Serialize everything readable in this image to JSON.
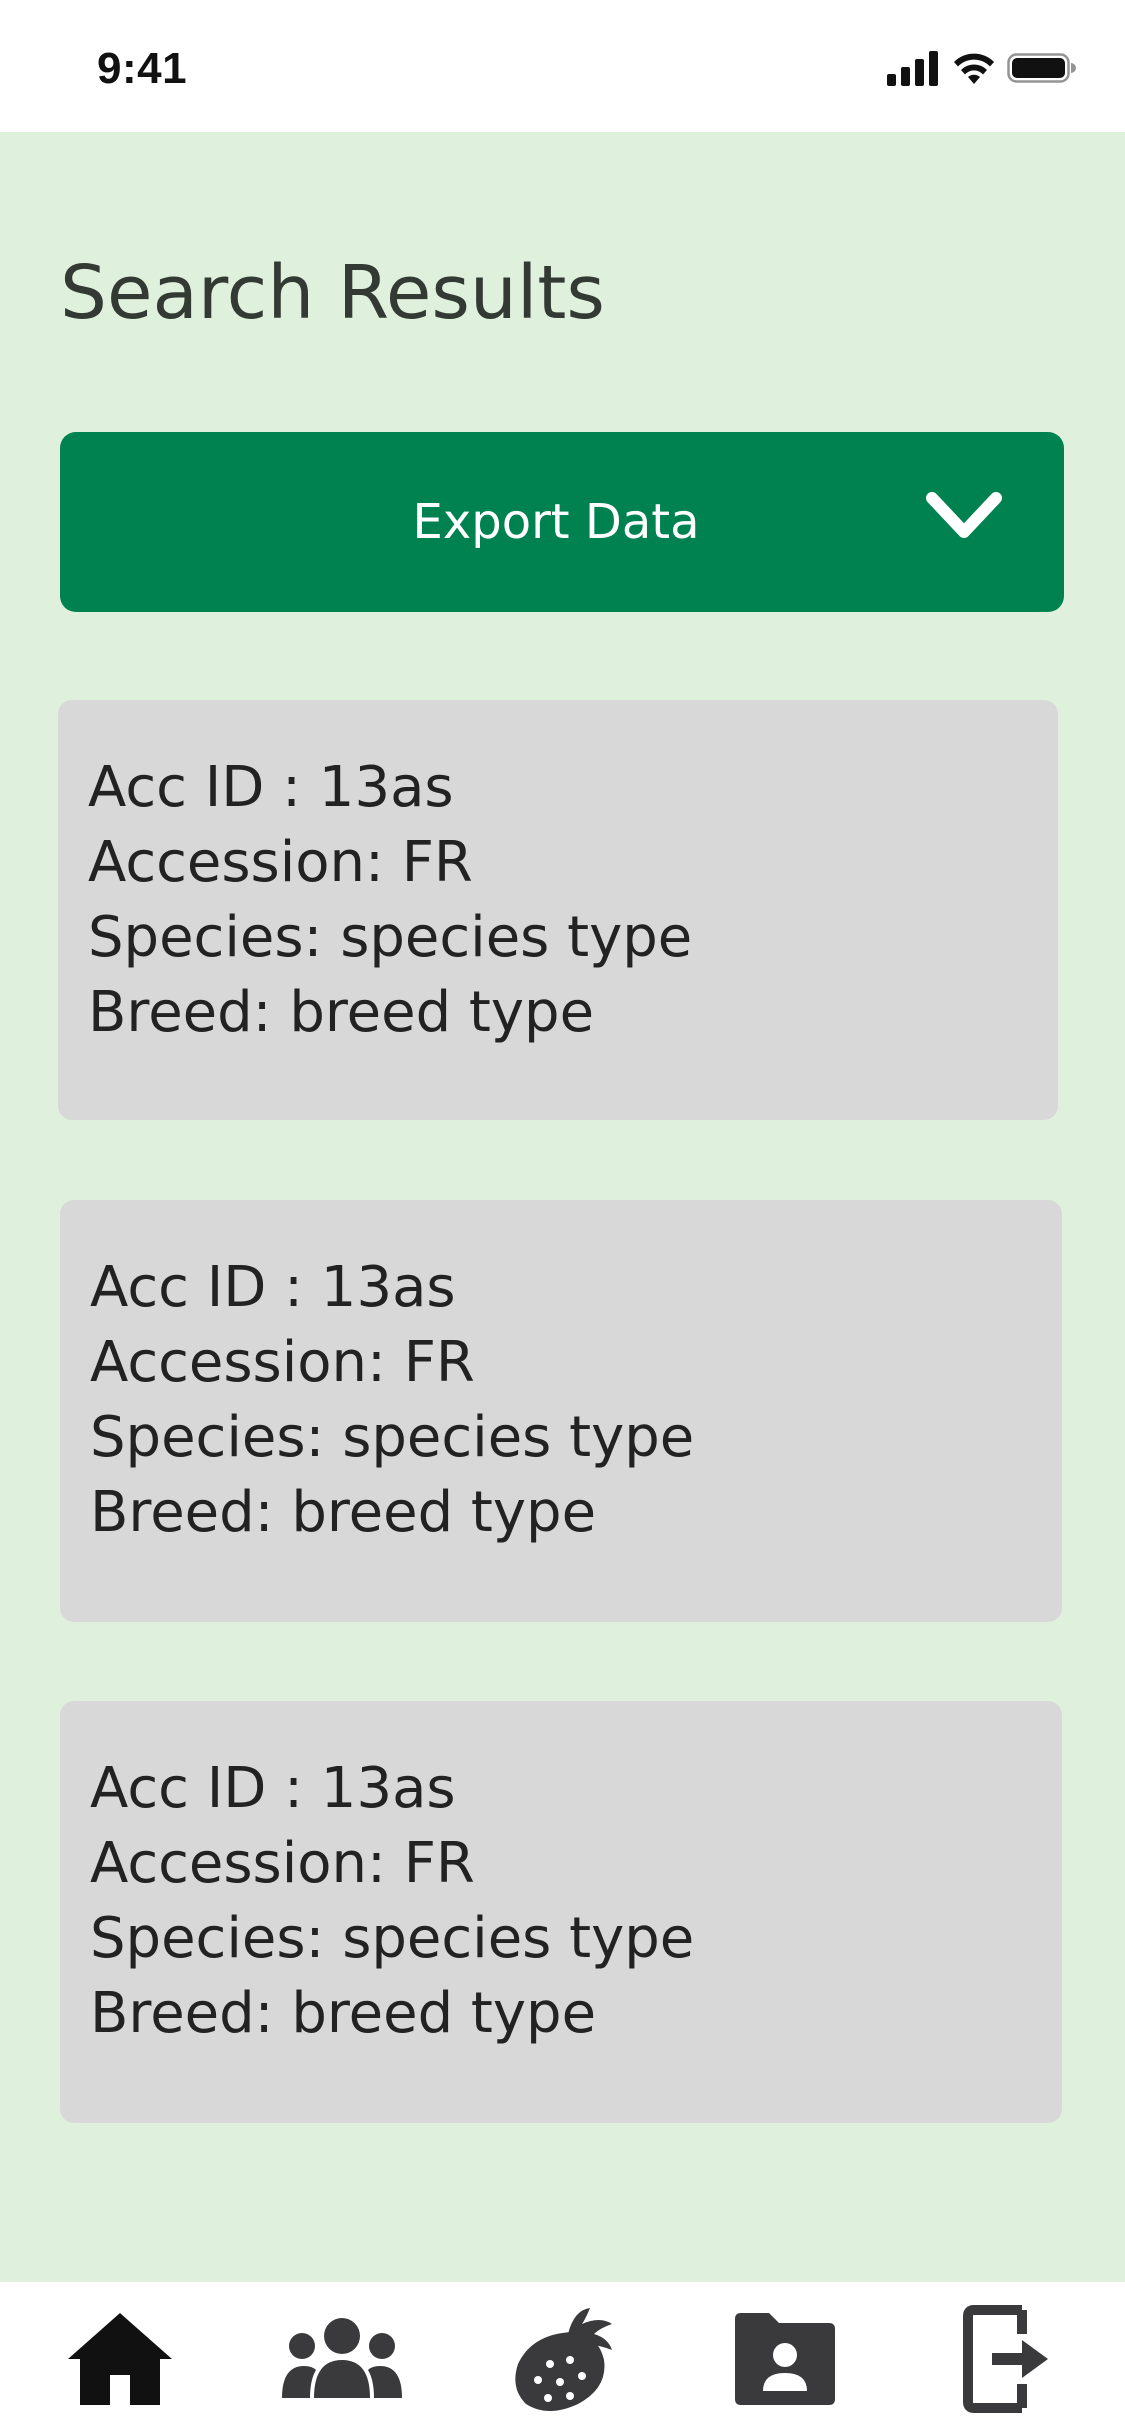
{
  "status_bar": {
    "time": "9:41"
  },
  "page": {
    "title": "Search Results"
  },
  "export": {
    "label": "Export Data",
    "icon": "chevron-down-icon"
  },
  "results": [
    {
      "acc_id": "Acc ID : 13as",
      "accession": "Accession: FR",
      "species": "Species: species type",
      "breed": "Breed: breed type"
    },
    {
      "acc_id": "Acc ID : 13as",
      "accession": "Accession: FR",
      "species": "Species: species type",
      "breed": "Breed: breed type"
    },
    {
      "acc_id": "Acc ID : 13as",
      "accession": "Accession: FR",
      "species": "Species: species type",
      "breed": "Breed: breed type"
    }
  ],
  "nav": [
    {
      "icon": "home-icon"
    },
    {
      "icon": "people-group-icon"
    },
    {
      "icon": "strawberry-icon"
    },
    {
      "icon": "contact-folder-icon"
    },
    {
      "icon": "logout-icon"
    }
  ],
  "colors": {
    "background": "#dff0dd",
    "accent": "#008250",
    "card": "#d8d8d8",
    "title_text": "#333a33"
  }
}
